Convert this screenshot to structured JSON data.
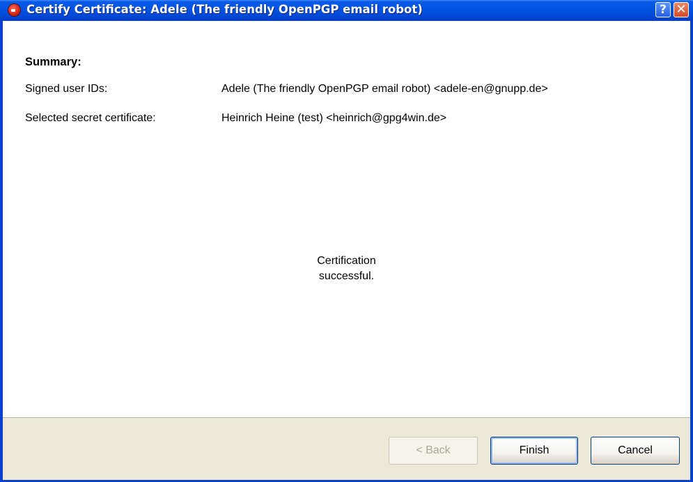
{
  "window": {
    "title": "Certify Certificate: Adele (The friendly OpenPGP email robot)",
    "help_glyph": "?",
    "close_glyph": "✕"
  },
  "summary": {
    "heading": "Summary:",
    "rows": [
      {
        "label": "Signed user IDs:",
        "value": "Adele (The friendly OpenPGP email robot) <adele-en@gnupp.de>"
      },
      {
        "label": "Selected secret certificate:",
        "value": "Heinrich Heine (test) <heinrich@gpg4win.de>"
      }
    ]
  },
  "status": {
    "line1": "Certification",
    "line2": "successful."
  },
  "buttons": {
    "back": "< Back",
    "finish": "Finish",
    "cancel": "Cancel"
  },
  "icons": {
    "app": "kleopatra-app-icon",
    "help": "help-icon",
    "close": "close-icon"
  },
  "colors": {
    "titlebar": "#0054e3",
    "dialog_bg": "#ffffff",
    "footer_bg": "#ece9d8",
    "button_border": "#003c74"
  }
}
